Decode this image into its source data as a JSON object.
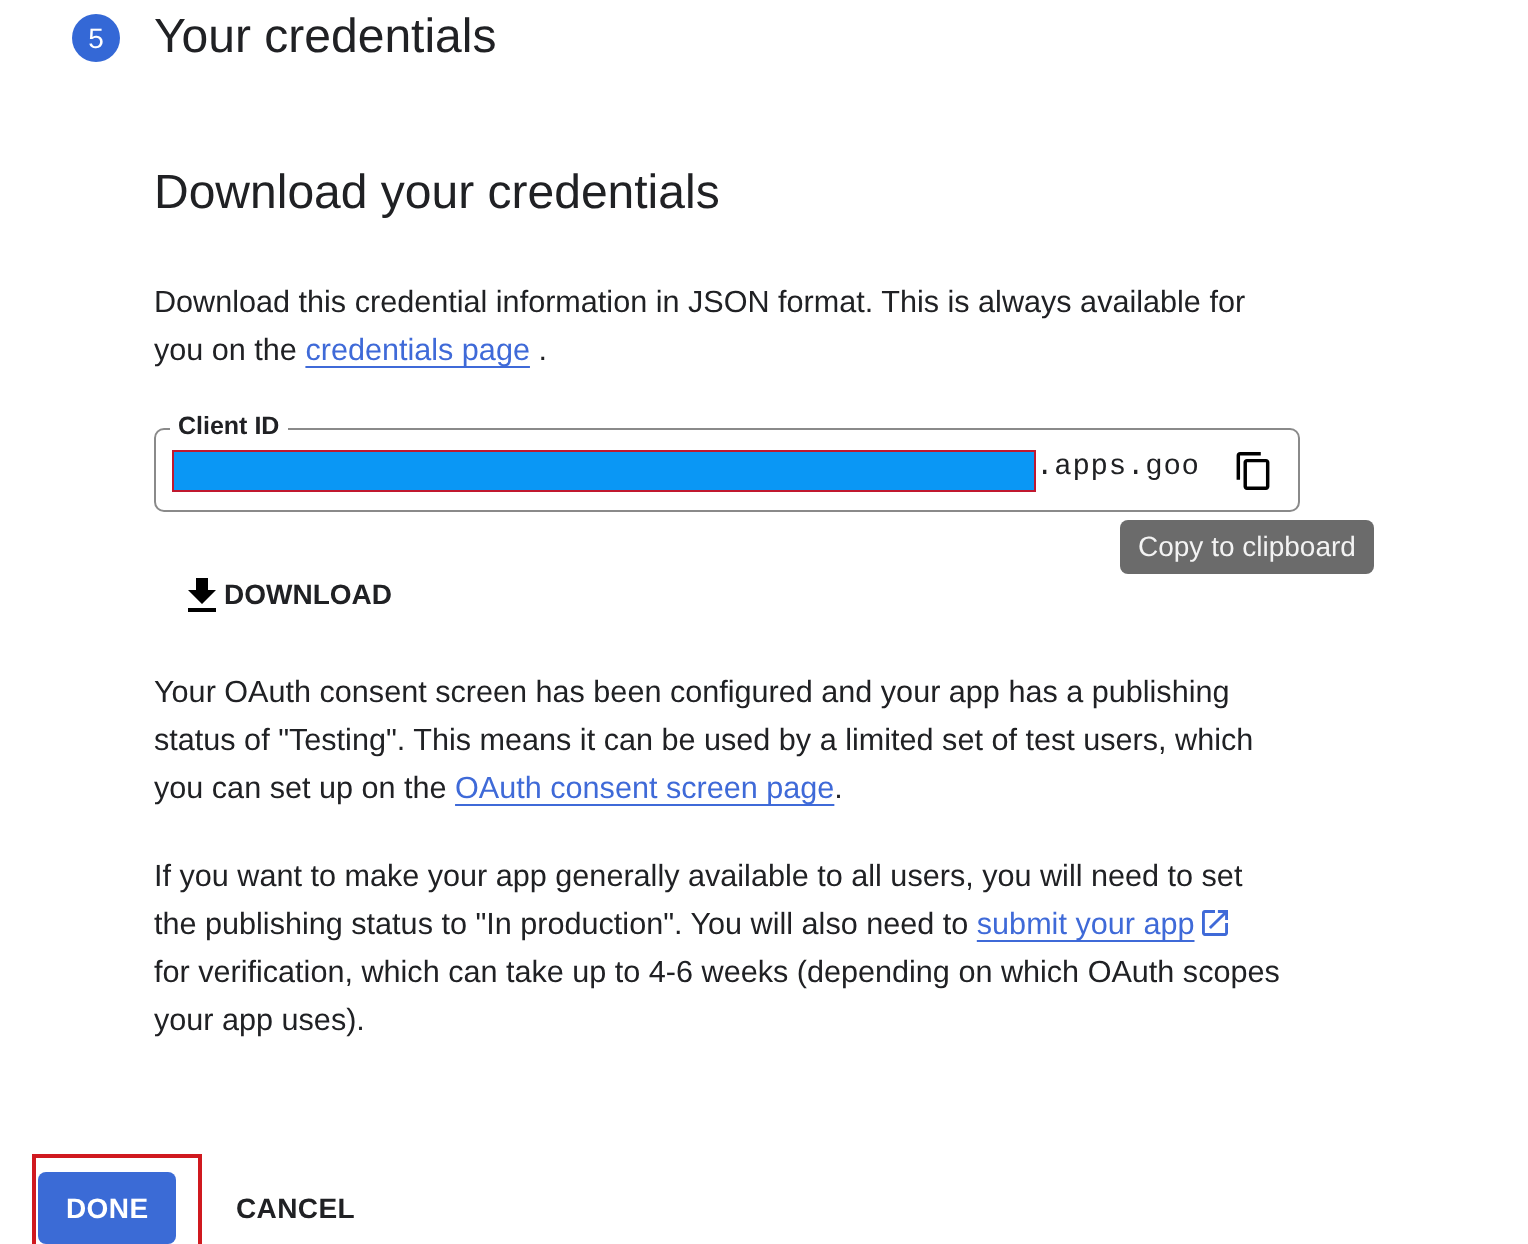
{
  "step": {
    "number": "5",
    "title": "Your credentials"
  },
  "section": {
    "title": "Download your credentials"
  },
  "intro": [
    {
      "kind": "text",
      "text": "Download this credential information in JSON format. This is always available for you on the "
    },
    {
      "kind": "link",
      "text": "credentials page",
      "external": false
    },
    {
      "kind": "text",
      "text": " ."
    }
  ],
  "client_id": {
    "label": "Client ID",
    "value": ".apps.goo",
    "redacted": true
  },
  "tooltip": "Copy to clipboard",
  "download_button": "DOWNLOAD",
  "paragraphs": [
    [
      {
        "kind": "text",
        "text": "Your OAuth consent screen has been configured and your app has a publishing status of \"Testing\". This means it can be used by a limited set of test users, which you can set up on the "
      },
      {
        "kind": "link",
        "text": "OAuth consent screen page",
        "external": false
      },
      {
        "kind": "text",
        "text": "."
      }
    ],
    [
      {
        "kind": "text",
        "text": "If you want to make your app generally available to all users, you will need to set the publishing status to \"In production\". You will also need to "
      },
      {
        "kind": "link",
        "text": "submit your app",
        "external": true
      },
      {
        "kind": "text",
        "text": " for verification, which can take up to 4-6 weeks (depending on which OAuth scopes your app uses)."
      }
    ]
  ],
  "buttons": [
    {
      "label": "DONE",
      "kind": "primary",
      "highlighted": true
    },
    {
      "label": "CANCEL",
      "kind": "text",
      "highlighted": false
    }
  ]
}
